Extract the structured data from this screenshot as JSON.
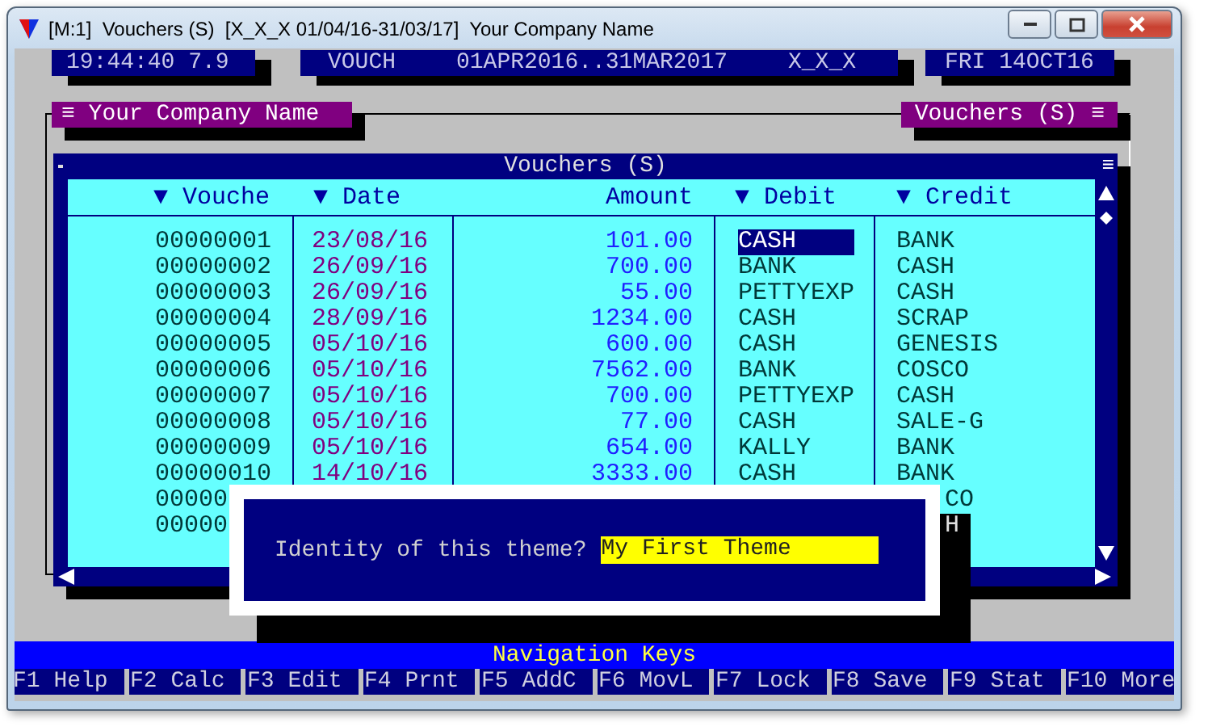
{
  "window": {
    "title": "[M:1]  Vouchers (S)  [X_X_X 01/04/16-31/03/17]  Your Company Name"
  },
  "status_bar": {
    "time": "19:44:40 7.9",
    "module": "VOUCH",
    "period": "01APR2016..31MAR2017",
    "company_code": "X_X_X",
    "date": "FRI 14OCT16"
  },
  "panel_labels": {
    "left": "≡ Your Company Name",
    "right": "Vouchers (S) ≡"
  },
  "table": {
    "title": "Vouchers (S)",
    "menu_glyph": "≡",
    "columns": [
      "▼ Vouche",
      "▼ Date",
      "Amount",
      "▼ Debit",
      "▼ Credit"
    ],
    "rows": [
      {
        "kind": "full",
        "selected": true,
        "voucher": "00000001",
        "date": "23/08/16",
        "amount": "101.00",
        "debit": "CASH",
        "credit": "BANK"
      },
      {
        "kind": "full",
        "selected": false,
        "voucher": "00000002",
        "date": "26/09/16",
        "amount": "700.00",
        "debit": "BANK",
        "credit": "CASH"
      },
      {
        "kind": "full",
        "selected": false,
        "voucher": "00000003",
        "date": "26/09/16",
        "amount": "55.00",
        "debit": "PETTYEXP",
        "credit": "CASH"
      },
      {
        "kind": "full",
        "selected": false,
        "voucher": "00000004",
        "date": "28/09/16",
        "amount": "1234.00",
        "debit": "CASH",
        "credit": "SCRAP"
      },
      {
        "kind": "full",
        "selected": false,
        "voucher": "00000005",
        "date": "05/10/16",
        "amount": "600.00",
        "debit": "CASH",
        "credit": "GENESIS"
      },
      {
        "kind": "full",
        "selected": false,
        "voucher": "00000006",
        "date": "05/10/16",
        "amount": "7562.00",
        "debit": "BANK",
        "credit": "COSCO"
      },
      {
        "kind": "full",
        "selected": false,
        "voucher": "00000007",
        "date": "05/10/16",
        "amount": "700.00",
        "debit": "PETTYEXP",
        "credit": "CASH"
      },
      {
        "kind": "full",
        "selected": false,
        "voucher": "00000008",
        "date": "05/10/16",
        "amount": "77.00",
        "debit": "CASH",
        "credit": "SALE-G"
      },
      {
        "kind": "full",
        "selected": false,
        "voucher": "00000009",
        "date": "05/10/16",
        "amount": "654.00",
        "debit": "KALLY",
        "credit": "BANK"
      },
      {
        "kind": "full",
        "selected": false,
        "voucher": "00000010",
        "date": "14/10/16",
        "amount": "3333.00",
        "debit": "CASH",
        "credit": "BANK"
      },
      {
        "kind": "partial",
        "shadowed": false,
        "voucher": "00000",
        "credit": "CO"
      },
      {
        "kind": "partial",
        "shadowed": true,
        "voucher": "00000",
        "credit": "H"
      }
    ]
  },
  "dialog": {
    "prompt": "Identity of this theme?",
    "value": "My First Theme"
  },
  "navigation": {
    "title": "Navigation Keys",
    "keys": [
      "F1 Help",
      "F2 Calc",
      "F3 Edit",
      "F4 Prnt",
      "F5 AddC",
      "F6 MovL",
      "F7 Lock",
      "F8 Save",
      "F9 Stat",
      "F10 More"
    ]
  }
}
